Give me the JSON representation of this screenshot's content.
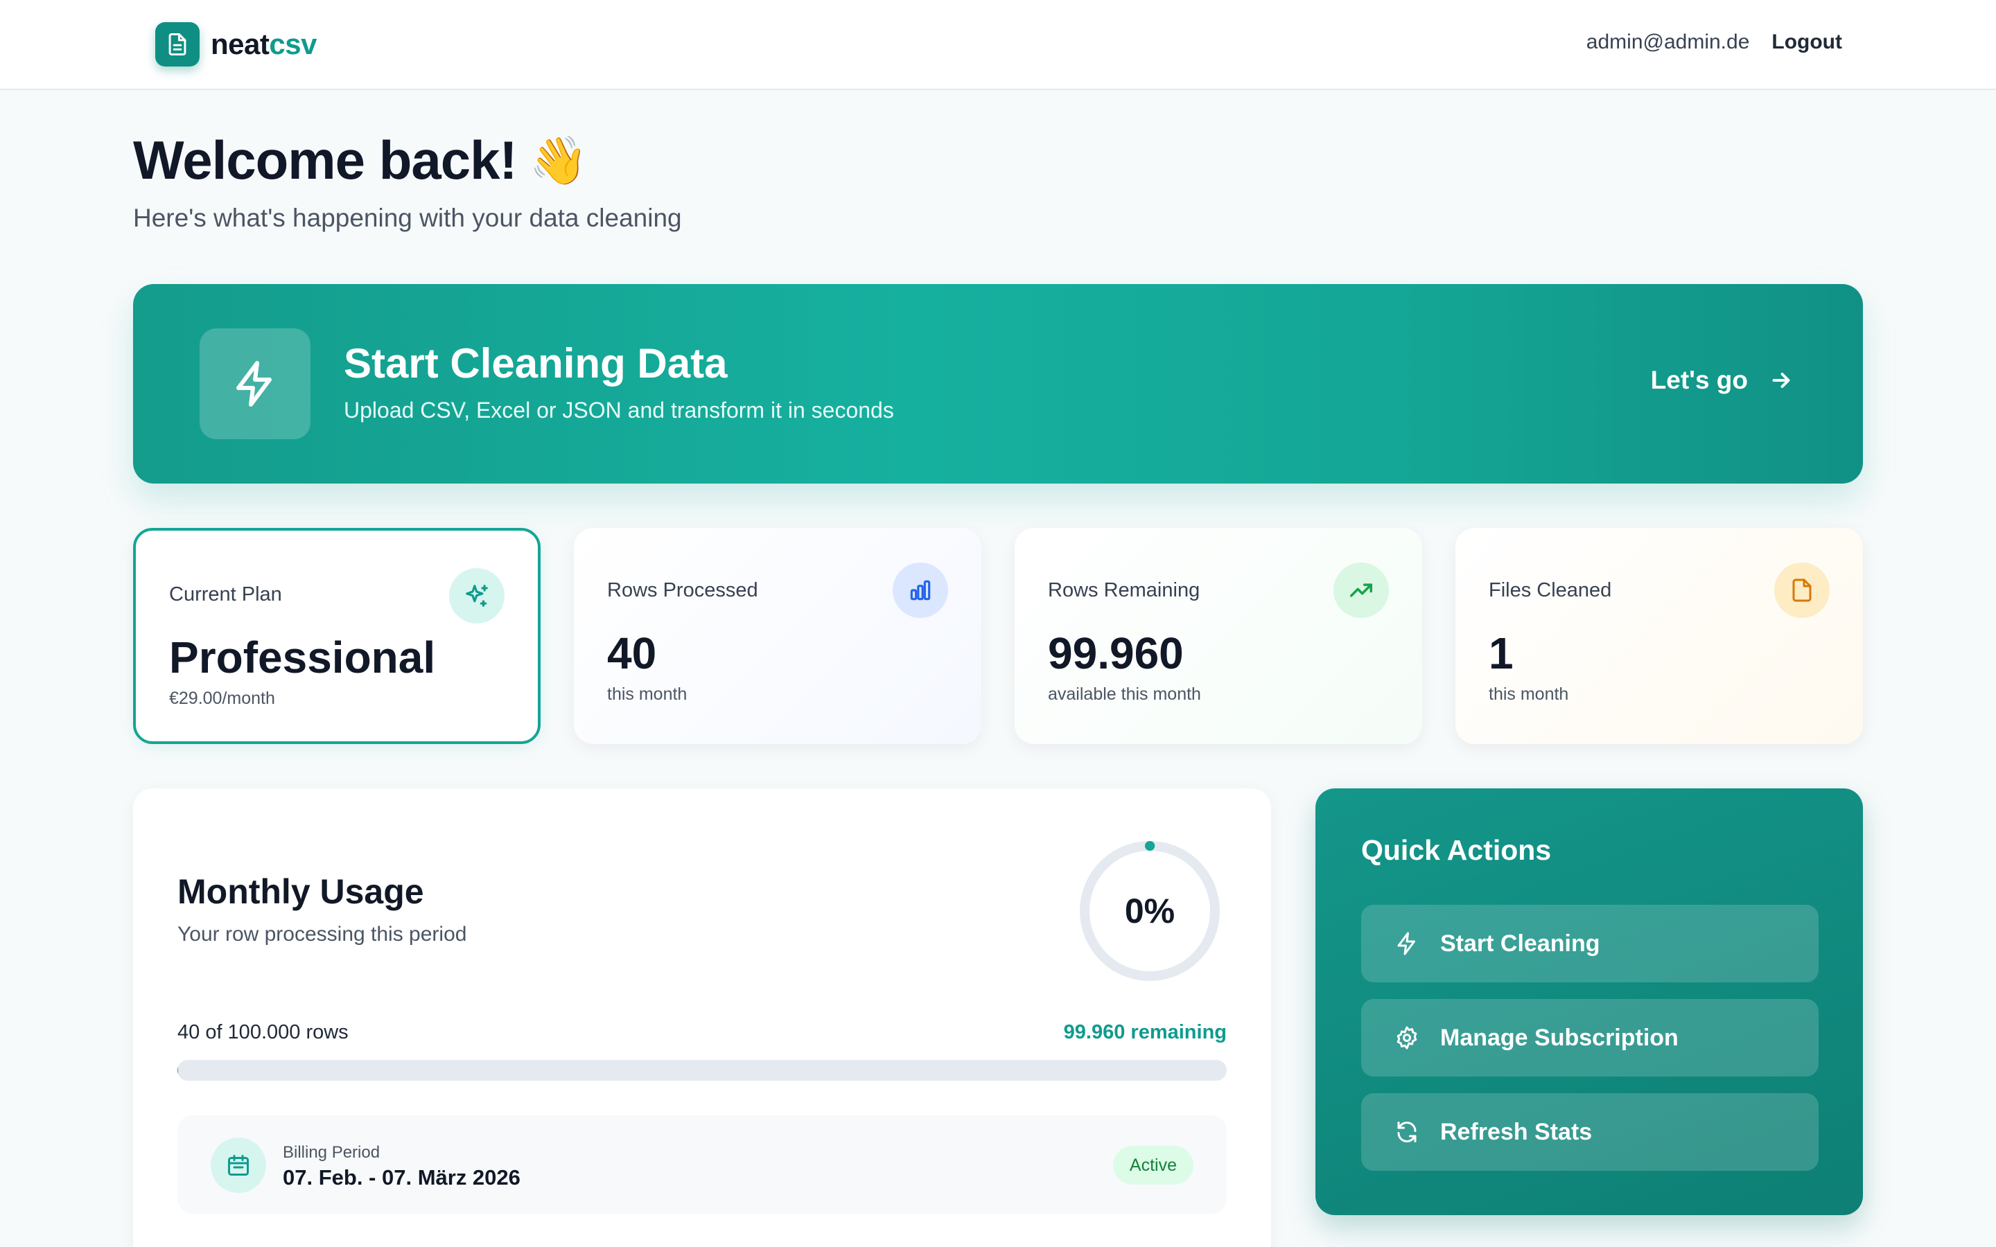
{
  "header": {
    "logo_part1": "neat",
    "logo_part2": "csv",
    "user_email": "admin@admin.de",
    "logout_label": "Logout"
  },
  "welcome": {
    "title": "Welcome back!",
    "emoji": "👋",
    "subtitle": "Here's what's happening with your data cleaning"
  },
  "banner": {
    "icon": "lightning-icon",
    "title": "Start Cleaning Data",
    "subtitle": "Upload CSV, Excel or JSON and transform it in seconds",
    "cta_label": "Let's go"
  },
  "stats": {
    "plan": {
      "label": "Current Plan",
      "value": "Professional",
      "note": "€29.00/month",
      "icon": "sparkles-icon"
    },
    "rows_processed": {
      "label": "Rows Processed",
      "value": "40",
      "note": "this month",
      "icon": "bar-chart-icon"
    },
    "rows_remaining": {
      "label": "Rows Remaining",
      "value": "99.960",
      "note": "available this month",
      "icon": "trending-up-icon"
    },
    "files_cleaned": {
      "label": "Files Cleaned",
      "value": "1",
      "note": "this month",
      "icon": "file-icon"
    }
  },
  "usage": {
    "title": "Monthly Usage",
    "subtitle": "Your row processing this period",
    "percent_label": "0%",
    "rows_used_text": "40 of 100.000 rows",
    "remaining_text": "99.960 remaining",
    "progress_fraction": 0.0004,
    "billing_label": "Billing Period",
    "billing_value": "07. Feb. - 07. März 2026",
    "status_badge": "Active"
  },
  "quick_actions": {
    "title": "Quick Actions",
    "items": [
      {
        "label": "Start Cleaning",
        "icon": "lightning-icon"
      },
      {
        "label": "Manage Subscription",
        "icon": "gear-icon"
      },
      {
        "label": "Refresh Stats",
        "icon": "refresh-icon"
      }
    ]
  },
  "colors": {
    "brand": "#0f9b8e",
    "accent_dark": "#0e7f74",
    "active_badge_bg": "#dcfce7",
    "active_badge_text": "#15803d"
  }
}
